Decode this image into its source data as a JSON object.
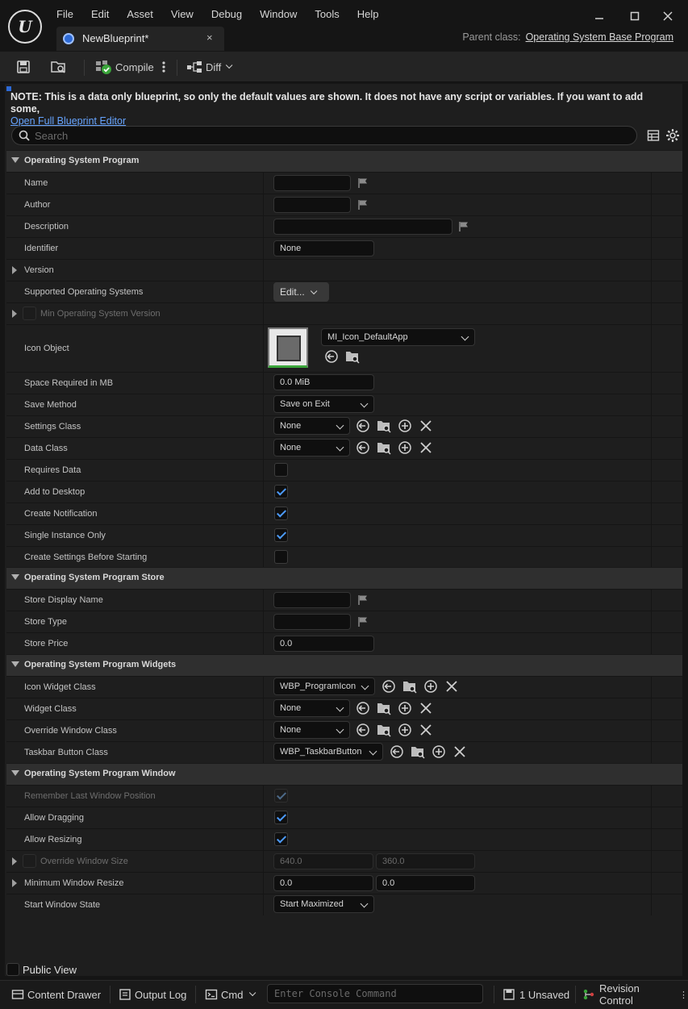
{
  "menu": [
    "File",
    "Edit",
    "Asset",
    "View",
    "Debug",
    "Window",
    "Tools",
    "Help"
  ],
  "tab": {
    "title": "NewBlueprint*",
    "close": "×"
  },
  "parent_class": {
    "label": "Parent class:",
    "value": "Operating System Base Program"
  },
  "toolbar": {
    "compile": "Compile",
    "diff": "Diff"
  },
  "note": {
    "text": "NOTE: This is a data only blueprint, so only the default values are shown.  It does not have any script or variables.  If you want to add some,",
    "link": "Open Full Blueprint Editor"
  },
  "search": {
    "placeholder": "Search"
  },
  "sections": {
    "program": "Operating System Program",
    "store": "Operating System Program Store",
    "widgets": "Operating System Program Widgets",
    "window": "Operating System Program Window"
  },
  "labels": {
    "name": "Name",
    "author": "Author",
    "description": "Description",
    "identifier": "Identifier",
    "version": "Version",
    "supported_os": "Supported Operating Systems",
    "min_os_version": "Min Operating System Version",
    "icon_object": "Icon Object",
    "space_required": "Space Required in MB",
    "save_method": "Save Method",
    "settings_class": "Settings Class",
    "data_class": "Data Class",
    "requires_data": "Requires Data",
    "add_to_desktop": "Add to Desktop",
    "create_notification": "Create Notification",
    "single_instance": "Single Instance Only",
    "create_settings": "Create Settings Before Starting",
    "store_display_name": "Store Display Name",
    "store_type": "Store Type",
    "store_price": "Store Price",
    "icon_widget_class": "Icon Widget Class",
    "widget_class": "Widget Class",
    "override_window_class": "Override Window Class",
    "taskbar_button_class": "Taskbar Button Class",
    "remember_last_pos": "Remember Last Window Position",
    "allow_dragging": "Allow Dragging",
    "allow_resizing": "Allow Resizing",
    "override_window_size": "Override Window Size",
    "min_window_resize": "Minimum Window Resize",
    "start_window_state": "Start Window State"
  },
  "values": {
    "identifier": "None",
    "supported_os_button": "Edit...",
    "icon_object": "MI_Icon_DefaultApp",
    "space_required": "0.0 MiB",
    "save_method": "Save on Exit",
    "settings_class": "None",
    "data_class": "None",
    "store_price": "0.0",
    "icon_widget_class": "WBP_ProgramIcon",
    "widget_class": "None",
    "override_window_class": "None",
    "taskbar_button_class": "WBP_TaskbarButton",
    "override_window_size_x": "640.0",
    "override_window_size_y": "360.0",
    "min_window_resize_x": "0.0",
    "min_window_resize_y": "0.0",
    "start_window_state": "Start Maximized"
  },
  "checks": {
    "requires_data": false,
    "add_to_desktop": true,
    "create_notification": true,
    "single_instance": true,
    "create_settings": false,
    "remember_last_pos": true,
    "allow_dragging": true,
    "allow_resizing": true
  },
  "bottom": {
    "public_view": "Public View",
    "content_drawer": "Content Drawer",
    "output_log": "Output Log",
    "cmd": "Cmd",
    "console_placeholder": "Enter Console Command",
    "unsaved": "1 Unsaved",
    "revision_control": "Revision Control"
  },
  "colors": {
    "accent": "#4d9cff",
    "link": "#66a4ff",
    "panel": "#1e1e1e",
    "category": "#2f2f2f"
  }
}
